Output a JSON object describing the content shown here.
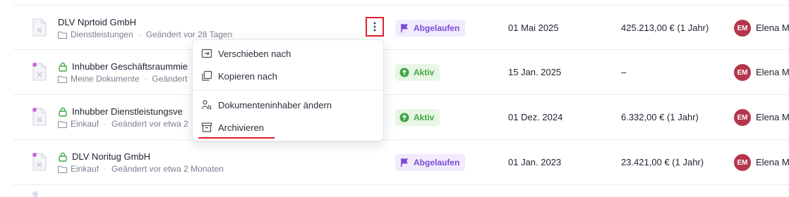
{
  "rows": [
    {
      "title": "DLV Nprtoid GmbH",
      "folder": "Dienstleistungen",
      "modified": "Geändert vor 28 Tagen",
      "status": "Abgelaufen",
      "date": "01 Mai 2025",
      "amount": "425.213,00 € (1 Jahr)",
      "avatar": "EM",
      "owner": "Elena M"
    },
    {
      "title": "Inhubber Geschäftsraummie",
      "folder": "Meine Dokumente",
      "modified": "Geändert",
      "status": "Aktiv",
      "date": "15 Jan. 2025",
      "amount": "–",
      "avatar": "EM",
      "owner": "Elena M"
    },
    {
      "title": "Inhubber Dienstleistungsve",
      "folder": "Einkauf",
      "modified": "Geändert vor etwa 2",
      "status": "Aktiv",
      "date": "01 Dez. 2024",
      "amount": "6.332,00 € (1 Jahr)",
      "avatar": "EM",
      "owner": "Elena M"
    },
    {
      "title": "DLV Noritug GmbH",
      "folder": "Einkauf",
      "modified": "Geändert vor etwa 2 Monaten",
      "status": "Abgelaufen",
      "date": "01 Jan. 2023",
      "amount": "23.421,00 € (1 Jahr)",
      "avatar": "EM",
      "owner": "Elena M"
    }
  ],
  "menu": {
    "items": [
      {
        "label": "Verschieben nach",
        "icon": "move-icon"
      },
      {
        "label": "Kopieren nach",
        "icon": "copy-icon"
      },
      {
        "label": "Dokumenteninhaber ändern",
        "icon": "change-owner-icon"
      },
      {
        "label": "Archivieren",
        "icon": "archive-icon"
      }
    ]
  },
  "colors": {
    "expired_bg": "#f1ebfd",
    "expired_fg": "#7b4bd6",
    "active_bg": "#e8f6e6",
    "active_fg": "#3da842",
    "avatar_bg": "#b5364a",
    "highlight": "#e0202f"
  }
}
